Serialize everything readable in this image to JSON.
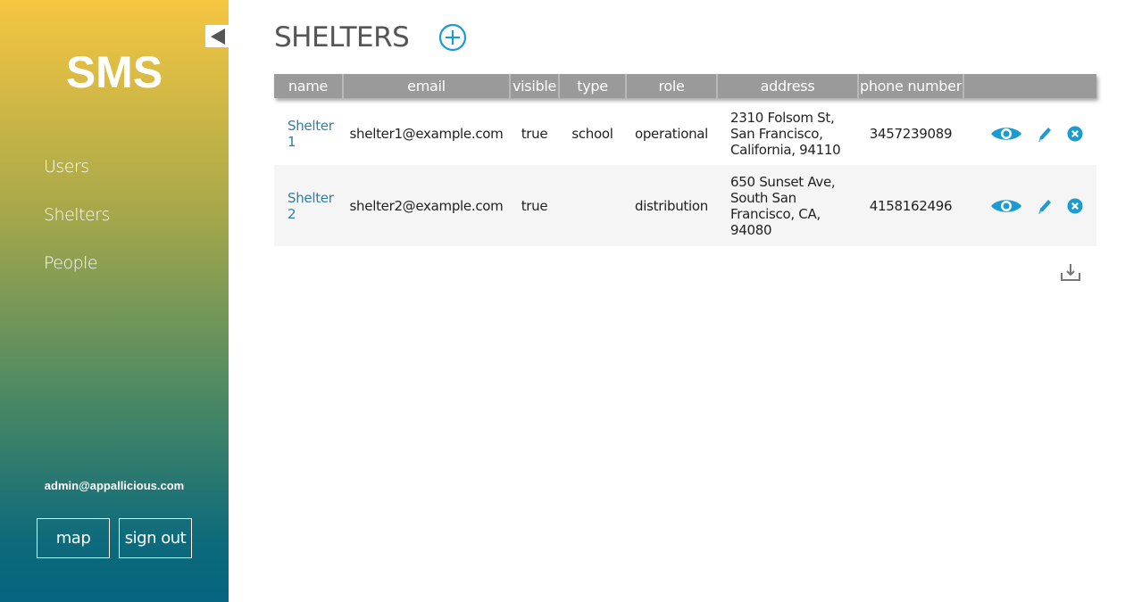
{
  "sidebar": {
    "brand": "SMS",
    "nav": [
      {
        "label": "Users"
      },
      {
        "label": "Shelters"
      },
      {
        "label": "People"
      }
    ],
    "user_email": "admin@appallicious.com",
    "map_label": "map",
    "signout_label": "sign out"
  },
  "main": {
    "title": "SHELTERS",
    "table": {
      "columns": [
        "name",
        "email",
        "visible",
        "type",
        "role",
        "address",
        "phone number",
        ""
      ],
      "rows": [
        {
          "name": "Shelter 1",
          "email": "shelter1@example.com",
          "visible": "true",
          "type": "school",
          "role": "operational",
          "address": "2310 Folsom St, San Francisco, California, 94110",
          "phone": "3457239089"
        },
        {
          "name": "Shelter 2",
          "email": "shelter2@example.com",
          "visible": "true",
          "type": "",
          "role": "distribution",
          "address": "650 Sunset Ave, South San Francisco, CA, 94080",
          "phone": "4158162496"
        }
      ]
    }
  },
  "icons": {
    "collapse": "triangle-left-icon",
    "add": "plus-circle-icon",
    "view": "eye-icon",
    "edit": "pencil-icon",
    "delete": "x-circle-icon",
    "download": "download-icon"
  },
  "colors": {
    "accent": "#1a9bd1",
    "header_bg": "#9a9a9a",
    "link": "#2f7fa8",
    "sidebar_top": "#f6c641",
    "sidebar_bottom": "#05647f"
  }
}
